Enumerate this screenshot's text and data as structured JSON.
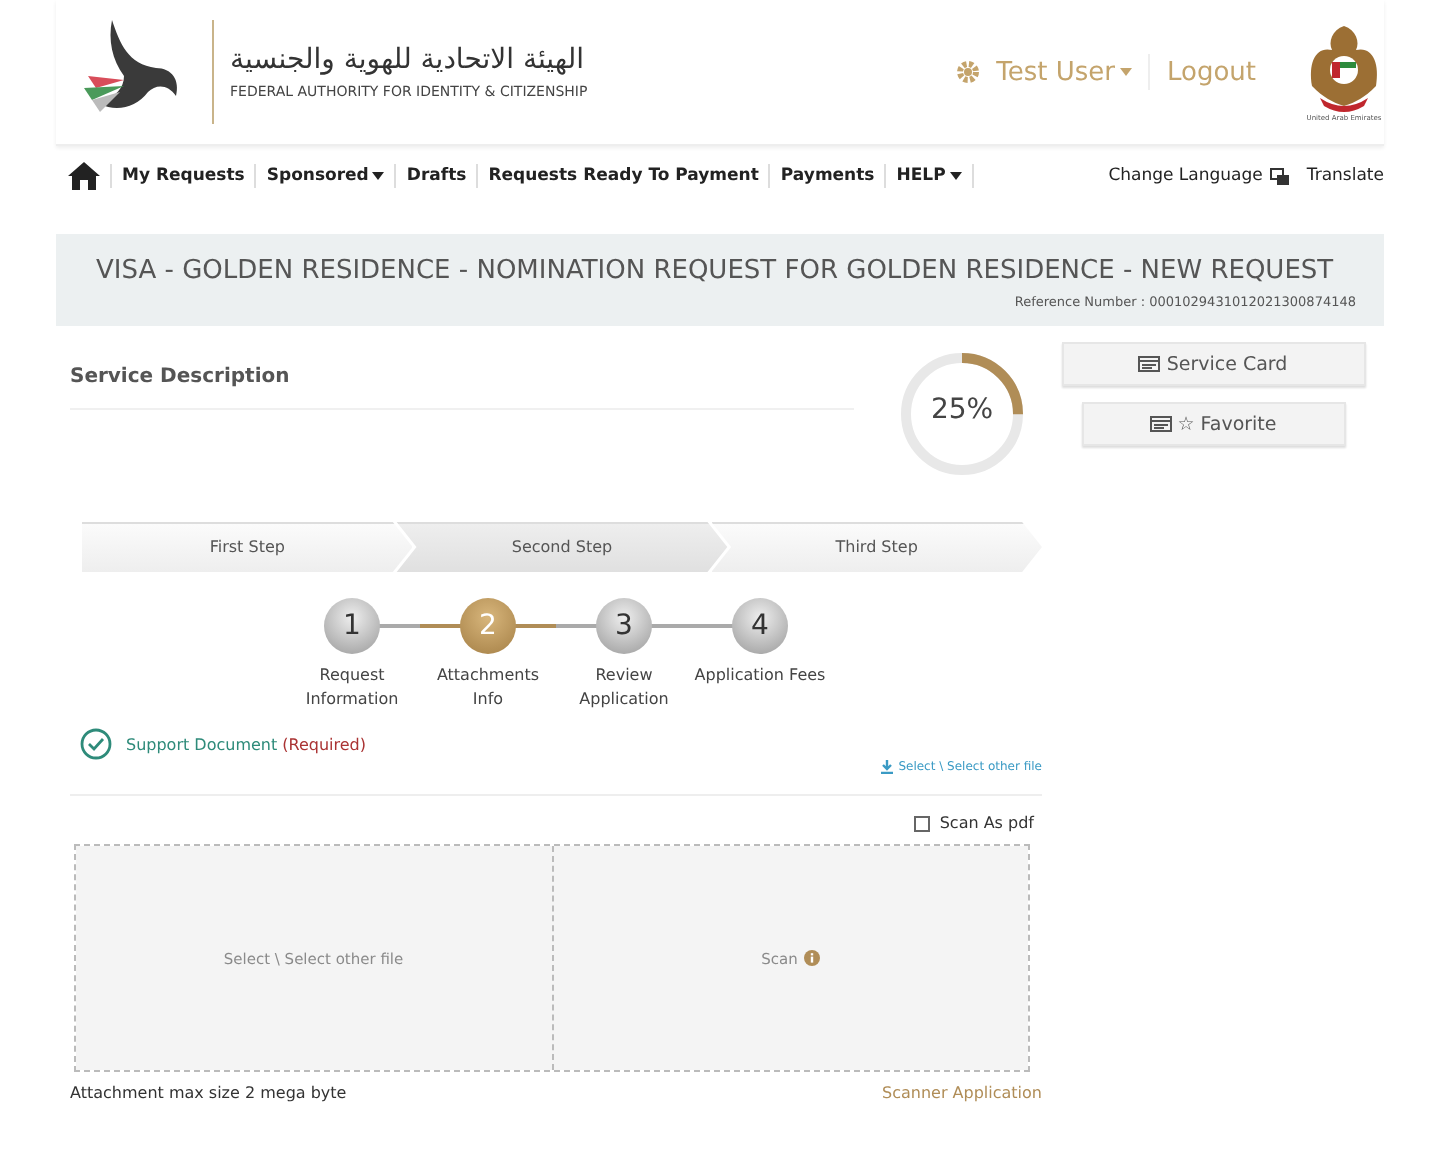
{
  "header": {
    "org_name_arabic": "الهيئة الاتحادية للهوية والجنسية",
    "org_name": "FEDERAL AUTHORITY FOR IDENTITY & CITIZENSHIP",
    "user": "Test User",
    "logout": "Logout",
    "emblem_caption": "United Arab Emirates"
  },
  "nav": {
    "items": [
      {
        "label": "My Requests",
        "dropdown": false
      },
      {
        "label": "Sponsored",
        "dropdown": true
      },
      {
        "label": "Drafts",
        "dropdown": false
      },
      {
        "label": "Requests Ready To Payment",
        "dropdown": false
      },
      {
        "label": "Payments",
        "dropdown": false
      },
      {
        "label": "HELP",
        "dropdown": true
      }
    ],
    "right": [
      "Change Language",
      "Translate"
    ]
  },
  "title": {
    "text": "VISA - GOLDEN RESIDENCE - NOMINATION REQUEST FOR GOLDEN RESIDENCE - NEW REQUEST",
    "reference": "Reference Number : 0001029431012021300874148"
  },
  "service_description": "Service Description",
  "progress": {
    "level": 0.25,
    "label": "25%"
  },
  "side_buttons": [
    "Service Card",
    "☆ Favorite"
  ],
  "wizard": [
    {
      "label": "First Step",
      "selected": false
    },
    {
      "label": "Second Step",
      "selected": true
    },
    {
      "label": "Third Step",
      "selected": false
    }
  ],
  "steps": [
    {
      "number": "1",
      "label": "Request Information",
      "selected": false
    },
    {
      "number": "2",
      "label": "Attachments Info",
      "selected": true
    },
    {
      "number": "3",
      "label": "Review Application",
      "selected": false
    },
    {
      "number": "4",
      "label": "Application Fees",
      "selected": false
    }
  ],
  "document": {
    "label": "Support Document",
    "required": "(Required)",
    "select_link": "Select \\ Select other file",
    "scan_as_pdf": {
      "label": "Scan As pdf",
      "checked": false
    },
    "select_area": "Select \\ Select other file",
    "scan_area": "Scan"
  },
  "footer": {
    "note": "Attachment max size 2 mega byte",
    "scanner_link": "Scanner Application"
  }
}
